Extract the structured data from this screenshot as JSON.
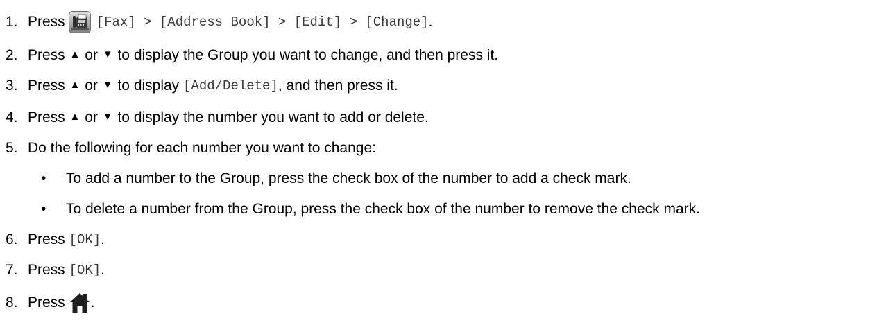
{
  "steps": [
    {
      "number": "1.",
      "prefix": "Press",
      "icon": "fax-icon",
      "ui_text": "[Fax] > [Address Book] > [Edit] > [Change]",
      "suffix": "."
    },
    {
      "number": "2.",
      "prefix": "Press",
      "up_arrow": "▲",
      "or_text": "or",
      "down_arrow": "▼",
      "text": "to display the Group you want to change, and then press it."
    },
    {
      "number": "3.",
      "prefix": "Press",
      "up_arrow": "▲",
      "or_text": "or",
      "down_arrow": "▼",
      "text": "to display",
      "ui_text": "[Add/Delete]",
      "suffix": ", and then press it."
    },
    {
      "number": "4.",
      "prefix": "Press",
      "up_arrow": "▲",
      "or_text": "or",
      "down_arrow": "▼",
      "text": "to display the number you want to add or delete."
    },
    {
      "number": "5.",
      "text": "Do the following for each number you want to change:",
      "bullets": [
        {
          "marker": "•",
          "text": "To add a number to the Group, press the check box of the number to add a check mark."
        },
        {
          "marker": "•",
          "text": "To delete a number from the Group, press the check box of the number to remove the check mark."
        }
      ]
    },
    {
      "number": "6.",
      "prefix": "Press",
      "ui_text": "[OK]",
      "suffix": "."
    },
    {
      "number": "7.",
      "prefix": "Press",
      "ui_text": "[OK]",
      "suffix": "."
    },
    {
      "number": "8.",
      "prefix": "Press",
      "icon": "home-icon",
      "suffix": "."
    }
  ],
  "colors": {
    "text": "#000000",
    "mono_text": "#3a3a3a",
    "home_icon": "#1f1f1f"
  }
}
